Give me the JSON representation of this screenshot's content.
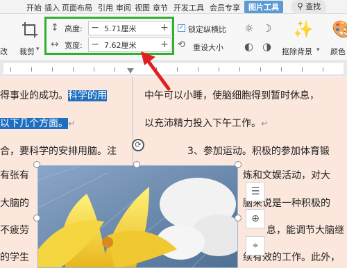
{
  "tabs": {
    "items": [
      "开始",
      "插入",
      "页面布局",
      "引用",
      "审阅",
      "视图",
      "章节",
      "开发工具",
      "会员专享",
      "图片工具"
    ],
    "active": "图片工具",
    "search_label": "查找"
  },
  "ribbon": {
    "crop_label": "裁剪",
    "crop_partial_label": "改",
    "height_label": "高度:",
    "height_value": "5.71厘米",
    "width_label": "宽度:",
    "width_value": "7.62厘米",
    "lock_ratio_label": "锁定纵横比",
    "reset_size_label": "重设大小",
    "remove_bg_label": "抠除背景",
    "color_label": "颜色"
  },
  "document": {
    "left_lines": [
      {
        "pre": "得事业的成功。",
        "hl": "科学的用"
      },
      {
        "pre": "",
        "hl": "以下几个方面。"
      },
      {
        "pre": "合，要科学的安排用脑。注",
        "hl": ""
      },
      {
        "pre": "有张有",
        "hl": ""
      },
      {
        "pre": "大脑的",
        "hl": ""
      },
      {
        "pre": "不疲劳",
        "hl": ""
      },
      {
        "pre": "的学生",
        "hl": ""
      }
    ],
    "right_lines": [
      "中午可以小睡，使脑细胞得到暂时休息，",
      "以充沛精力投入下午工作。",
      "3、参加运动。积极的参加体育锻",
      "炼和文娱活动，对大",
      "脑来说是一种积极的",
      "息，能调节大脑继",
      "续有效的工作。此外，"
    ]
  },
  "colors": {
    "highlight": "#1e6fc0",
    "annotation_box": "#2fb12f",
    "annotation_arrow": "#e02020",
    "active_tab": "#5a9bd6",
    "page_bg": "#fbe7dc"
  }
}
